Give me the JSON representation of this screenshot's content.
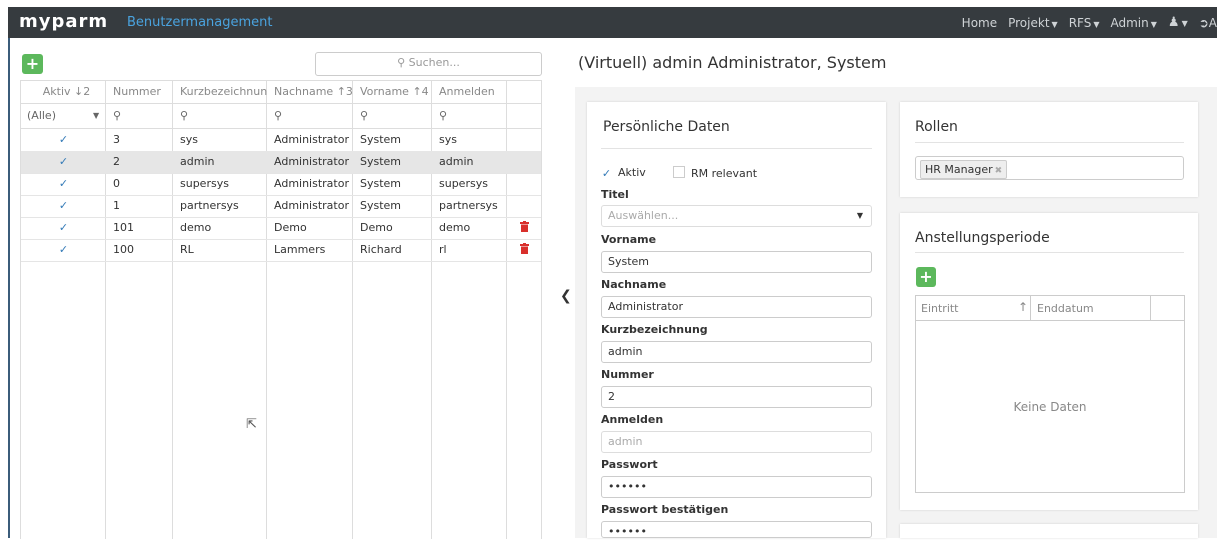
{
  "nav": {
    "brand": "myparm",
    "subtitle": "Benutzermanagement",
    "items": [
      "Home",
      "Projekt",
      "RFS",
      "Admin"
    ],
    "user_icon": "user-icon",
    "logout_label": "A"
  },
  "list": {
    "search_placeholder": "Suchen...",
    "add_label": "+",
    "columns": [
      {
        "label": "Aktiv",
        "sort": "↓2"
      },
      {
        "label": "Nummer",
        "sort": ""
      },
      {
        "label": "Kurzbezeichnung",
        "sort": ""
      },
      {
        "label": "Nachname",
        "sort": "↑3"
      },
      {
        "label": "Vorname",
        "sort": "↑4"
      },
      {
        "label": "Anmelden",
        "sort": ""
      }
    ],
    "filter_all": "(Alle)",
    "rows": [
      {
        "aktiv": "✓",
        "nummer": "3",
        "kurz": "sys",
        "nachname": "Administrator",
        "vorname": "System",
        "anmelden": "sys",
        "delete": false
      },
      {
        "aktiv": "✓",
        "nummer": "2",
        "kurz": "admin",
        "nachname": "Administrator",
        "vorname": "System",
        "anmelden": "admin",
        "delete": false
      },
      {
        "aktiv": "✓",
        "nummer": "0",
        "kurz": "supersys",
        "nachname": "Administrator",
        "vorname": "System",
        "anmelden": "supersys",
        "delete": false
      },
      {
        "aktiv": "✓",
        "nummer": "1",
        "kurz": "partnersys",
        "nachname": "Administrator",
        "vorname": "System",
        "anmelden": "partnersys",
        "delete": false
      },
      {
        "aktiv": "✓",
        "nummer": "101",
        "kurz": "demo",
        "nachname": "Demo",
        "vorname": "Demo",
        "anmelden": "demo",
        "delete": true
      },
      {
        "aktiv": "✓",
        "nummer": "100",
        "kurz": "RL",
        "nachname": "Lammers",
        "vorname": "Richard",
        "anmelden": "rl",
        "delete": true
      }
    ],
    "selected_row": 1
  },
  "detail": {
    "title": "(Virtuell) admin Administrator, System",
    "personal": {
      "title": "Persönliche Daten",
      "aktiv_label": "Aktiv",
      "rm_label": "RM relevant",
      "titel_label": "Titel",
      "titel_placeholder": "Auswählen...",
      "vorname_label": "Vorname",
      "vorname_value": "System",
      "nachname_label": "Nachname",
      "nachname_value": "Administrator",
      "kurz_label": "Kurzbezeichnung",
      "kurz_value": "admin",
      "nummer_label": "Nummer",
      "nummer_value": "2",
      "anmelden_label": "Anmelden",
      "anmelden_value": "admin",
      "passwort_label": "Passwort",
      "passwort_value": "••••••",
      "passwort2_label": "Passwort bestätigen",
      "passwort2_value": "••••••"
    },
    "rollen": {
      "title": "Rollen",
      "tags": [
        "HR Manager"
      ]
    },
    "anstellung": {
      "title": "Anstellungsperiode",
      "add_label": "+",
      "col_eintritt": "Eintritt",
      "col_sort": "↑",
      "col_enddatum": "Enddatum",
      "empty": "Keine Daten"
    }
  },
  "colors": {
    "navbar": "#363b3f",
    "accent": "#4aa3df",
    "add_button": "#5cb85c",
    "delete": "#d9302c",
    "check": "#337ab7"
  }
}
